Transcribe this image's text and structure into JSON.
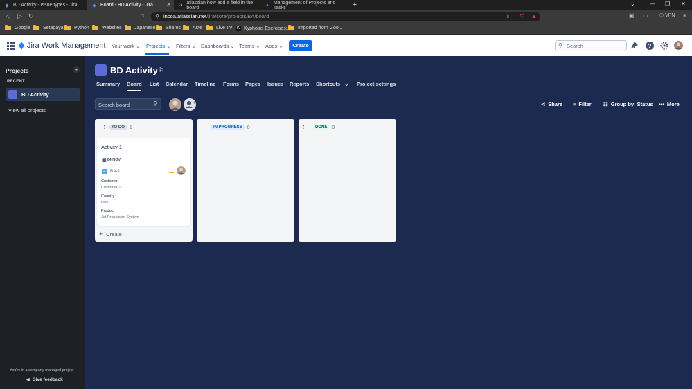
{
  "browser": {
    "tabs": [
      {
        "title": "BD Activity - Issue types - Jira",
        "active": false
      },
      {
        "title": "Board - BD Activity - Jira",
        "active": true
      },
      {
        "title": "atlassian how add a field in the board",
        "active": false
      },
      {
        "title": "Management of Projects and Tasks",
        "active": false
      }
    ],
    "url_host": "incoa.atlassian.net",
    "url_path": "/jira/core/projects/BA/board",
    "vpn_label": "VPN",
    "bookmarks": [
      "Google",
      "Setagaya",
      "Python",
      "Websites",
      "Japanese",
      "Shares",
      "Aste",
      "Live TV",
      "Kyphosis Exercises:...",
      "Imported from Goo..."
    ]
  },
  "topnav": {
    "product": "Jira Work Management",
    "items": [
      "Your work",
      "Projects",
      "Filters",
      "Dashboards",
      "Teams",
      "Apps"
    ],
    "create_label": "Create",
    "search_placeholder": "Search"
  },
  "sidebar": {
    "title": "Projects",
    "recent_label": "RECENT",
    "project_name": "BD Activity",
    "view_all": "View all projects",
    "footer_text": "You're in a company-managed project",
    "feedback": "Give feedback"
  },
  "project": {
    "name": "BD Activity",
    "tabs": [
      "Summary",
      "Board",
      "List",
      "Calendar",
      "Timeline",
      "Forms",
      "Pages",
      "Issues",
      "Reports",
      "Shortcuts",
      "Project settings"
    ]
  },
  "toolbar": {
    "search_placeholder": "Search board",
    "share": "Share",
    "filter": "Filter",
    "group_by": "Group by: Status",
    "more": "More"
  },
  "columns": [
    {
      "title": "TO DO",
      "count": "1",
      "color": "#42526e",
      "bg": "#dfe1e6"
    },
    {
      "title": "IN PROGRESS",
      "count": "0",
      "color": "#0052cc",
      "bg": "#deebff"
    },
    {
      "title": "DONE",
      "count": "0",
      "color": "#006644",
      "bg": "#e3fcef"
    }
  ],
  "card": {
    "title": "Activity 1",
    "date": "04 NOV",
    "key": "BA-1",
    "fields": [
      {
        "label": "Customer",
        "value": "Customer 1"
      },
      {
        "label": "Country",
        "value": "Italy"
      },
      {
        "label": "Product",
        "value": "Jet Propulsion System"
      }
    ]
  },
  "create_label": "Create"
}
